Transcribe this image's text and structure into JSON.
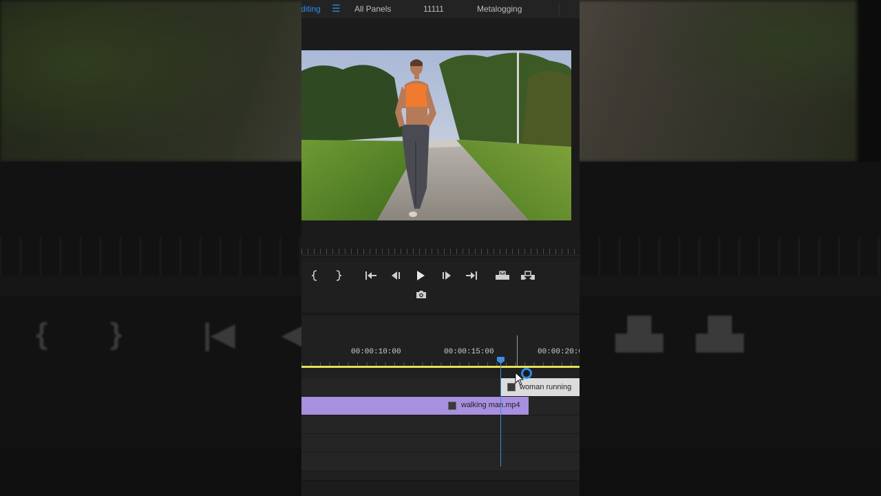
{
  "menubar": {
    "active_tab": "diting",
    "tabs": [
      "All Panels",
      "11111",
      "Metalogging"
    ]
  },
  "colors": {
    "accent": "#2d8ceb",
    "work_area_bar": "#e6e257",
    "clip_v1": "#a98fe0",
    "clip_v2": "#dcdcdc",
    "playhead": "#3b8de0"
  },
  "transport": {
    "buttons": [
      "mark-in-icon",
      "mark-out-icon",
      "go-to-in-icon",
      "step-back-icon",
      "play-icon",
      "step-forward-icon",
      "go-to-out-icon",
      "lift-icon",
      "extract-icon",
      "export-frame-icon"
    ]
  },
  "timeline": {
    "timecodes": [
      "00:00:10:00",
      "00:00:15:00",
      "00:00:20:00"
    ],
    "clips": [
      {
        "track": "V2",
        "name": "woman running"
      },
      {
        "track": "V1",
        "name": "walking man.mp4"
      }
    ]
  }
}
